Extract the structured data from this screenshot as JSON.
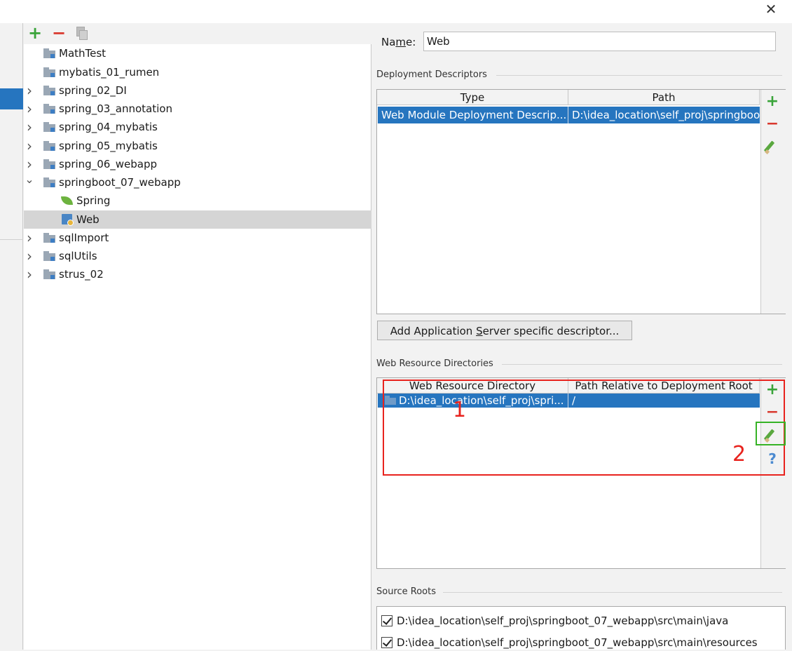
{
  "tree": {
    "toolbar": {
      "add": "+",
      "remove": "−"
    },
    "items": [
      {
        "label": "MathTest",
        "expandable": false,
        "expanded": false,
        "icon": "module-folder-icon"
      },
      {
        "label": "mybatis_01_rumen",
        "expandable": false,
        "expanded": false,
        "icon": "module-folder-icon"
      },
      {
        "label": "spring_02_DI",
        "expandable": true,
        "expanded": false,
        "icon": "module-folder-icon"
      },
      {
        "label": "spring_03_annotation",
        "expandable": true,
        "expanded": false,
        "icon": "module-folder-icon"
      },
      {
        "label": "spring_04_mybatis",
        "expandable": true,
        "expanded": false,
        "icon": "module-folder-icon"
      },
      {
        "label": "spring_05_mybatis",
        "expandable": true,
        "expanded": false,
        "icon": "module-folder-icon"
      },
      {
        "label": "spring_06_webapp",
        "expandable": true,
        "expanded": false,
        "icon": "module-folder-icon"
      },
      {
        "label": "springboot_07_webapp",
        "expandable": true,
        "expanded": true,
        "icon": "module-folder-icon"
      },
      {
        "label": "Spring",
        "child": true,
        "icon": "spring-leaf-icon"
      },
      {
        "label": "Web",
        "child": true,
        "selected": true,
        "icon": "web-facet-icon"
      },
      {
        "label": "sqlImport",
        "expandable": true,
        "expanded": false,
        "icon": "module-folder-icon"
      },
      {
        "label": "sqlUtils",
        "expandable": true,
        "expanded": false,
        "icon": "module-folder-icon"
      },
      {
        "label": "strus_02",
        "expandable": true,
        "expanded": false,
        "icon": "module-folder-icon"
      }
    ]
  },
  "name_field": {
    "label_pre": "Na",
    "label_mnemonic": "m",
    "label_post": "e:",
    "value": "Web"
  },
  "deployment": {
    "title": "Deployment Descriptors",
    "columns": [
      "Type",
      "Path"
    ],
    "rows": [
      {
        "type": "Web Module Deployment Descrip...",
        "path": "D:\\idea_location\\self_proj\\springboot"
      }
    ],
    "add_server_button": {
      "pre": "Add Application ",
      "mnemonic": "S",
      "post": "erver specific descriptor..."
    }
  },
  "web_resources": {
    "title": "Web Resource Directories",
    "columns": [
      "Web Resource Directory",
      "Path Relative to Deployment Root"
    ],
    "rows": [
      {
        "directory": "D:\\idea_location\\self_proj\\spri...",
        "relative": "/"
      }
    ],
    "help": "?"
  },
  "source_roots": {
    "title": "Source Roots",
    "items": [
      {
        "path": "D:\\idea_location\\self_proj\\springboot_07_webapp\\src\\main\\java",
        "checked": true
      },
      {
        "path": "D:\\idea_location\\self_proj\\springboot_07_webapp\\src\\main\\resources",
        "checked": true
      }
    ]
  },
  "annotations": {
    "label1": "1",
    "label2": "2"
  },
  "window": {
    "close_glyph": "✕"
  },
  "colors": {
    "selection": "#2675bf",
    "add": "#3aa43a",
    "remove": "#d9392f",
    "annotation_red": "#e8231e",
    "annotation_green": "#36b326"
  }
}
